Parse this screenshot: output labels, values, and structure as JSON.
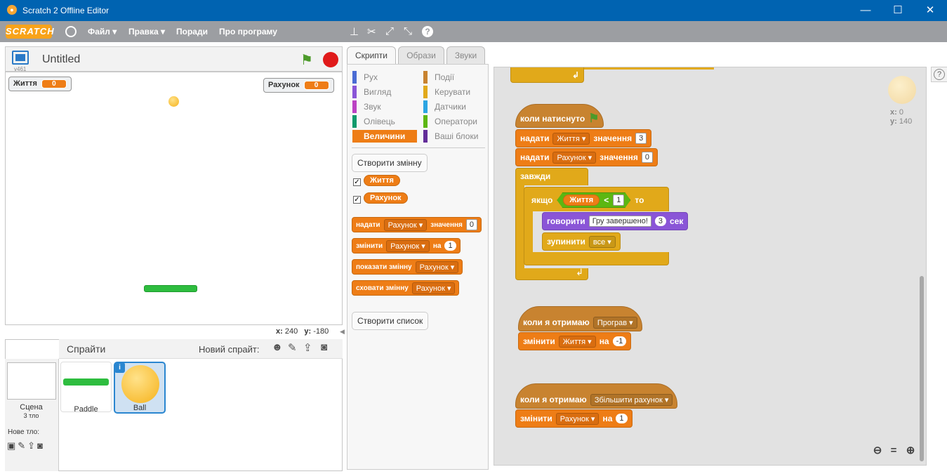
{
  "window": {
    "title": "Scratch 2 Offline Editor"
  },
  "menu": {
    "logo": "SCRATCH",
    "items": [
      "Файл",
      "Правка",
      "Поради",
      "Про програму"
    ]
  },
  "stage": {
    "project_title": "Untitled",
    "version": "v461",
    "coords": {
      "x_label": "x:",
      "x": "240",
      "y_label": "y:",
      "y": "-180"
    }
  },
  "monitors": [
    {
      "label": "Життя",
      "value": "0"
    },
    {
      "label": "Рахунок",
      "value": "0"
    }
  ],
  "sprites": {
    "header": "Спрайти",
    "new_sprite": "Новий спрайт:",
    "scene_label": "Сцена",
    "scene_sub": "3 тло",
    "new_backdrop": "Нове тло:",
    "items": [
      {
        "name": "Paddle"
      },
      {
        "name": "Ball"
      }
    ]
  },
  "tabs": [
    "Скрипти",
    "Образи",
    "Звуки"
  ],
  "categories": {
    "left": [
      "Рух",
      "Вигляд",
      "Звук",
      "Олівець",
      "Величини"
    ],
    "right": [
      "Події",
      "Керувати",
      "Датчики",
      "Оператори",
      "Ваші блоки"
    ]
  },
  "palette": {
    "create_var": "Створити змінну",
    "vars": [
      "Життя",
      "Рахунок"
    ],
    "create_list": "Створити список",
    "b1": {
      "a": "надати",
      "dd": "Рахунок",
      "b": "значення",
      "v": "0"
    },
    "b2": {
      "a": "змінити",
      "dd": "Рахунок",
      "b": "на",
      "v": "1"
    },
    "b3": {
      "a": "показати змінну",
      "dd": "Рахунок"
    },
    "b4": {
      "a": "сховати змінну",
      "dd": "Рахунок"
    }
  },
  "script1": {
    "hat": "коли натиснуто",
    "set1": {
      "a": "надати",
      "dd": "Життя",
      "b": "значення",
      "v": "3"
    },
    "set2": {
      "a": "надати",
      "dd": "Рахунок",
      "b": "значення",
      "v": "0"
    },
    "forever": "завжди",
    "if_a": "якщо",
    "if_var": "Життя",
    "if_op": "<",
    "if_v": "1",
    "if_b": "то",
    "say": {
      "a": "говорити",
      "text": "Гру завершено!",
      "secs": "3",
      "b": "сек"
    },
    "stop": {
      "a": "зупинити",
      "dd": "все"
    }
  },
  "script2": {
    "hat": "коли я отримаю",
    "msg": "Програв",
    "ch": {
      "a": "змінити",
      "dd": "Життя",
      "b": "на",
      "v": "-1"
    }
  },
  "script3": {
    "hat": "коли я отримаю",
    "msg": "Збільшити рахунок",
    "ch": {
      "a": "змінити",
      "dd": "Рахунок",
      "b": "на",
      "v": "1"
    }
  },
  "sprite_info": {
    "x_label": "x:",
    "x": "0",
    "y_label": "y:",
    "y": "140"
  },
  "colors": {
    "titlebar": "#0063b1",
    "menubar": "#9c9ea2",
    "data_block": "#ee7d16",
    "control_block": "#e1a91a",
    "event_block": "#c88330",
    "looks_block": "#8a55d7"
  }
}
